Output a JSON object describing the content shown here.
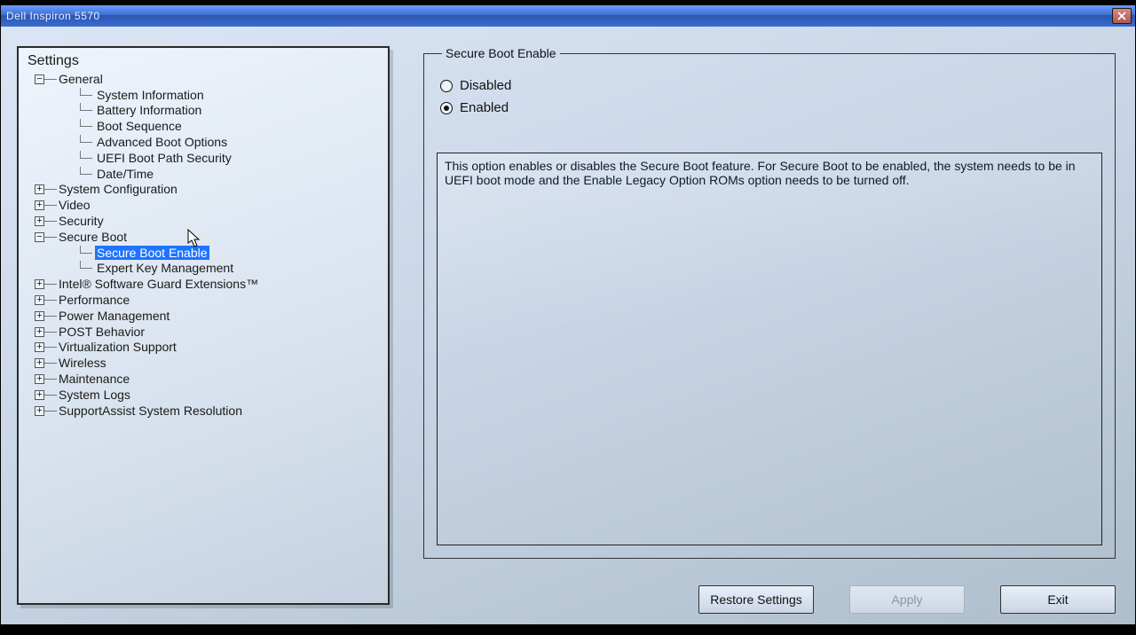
{
  "window": {
    "title": "Dell Inspiron 5570"
  },
  "tree": {
    "heading": "Settings",
    "nodes": [
      {
        "label": "General",
        "state": "expanded",
        "children": [
          {
            "label": "System Information"
          },
          {
            "label": "Battery Information"
          },
          {
            "label": "Boot Sequence"
          },
          {
            "label": "Advanced Boot Options"
          },
          {
            "label": "UEFI Boot Path Security"
          },
          {
            "label": "Date/Time"
          }
        ]
      },
      {
        "label": "System Configuration",
        "state": "collapsed"
      },
      {
        "label": "Video",
        "state": "collapsed"
      },
      {
        "label": "Security",
        "state": "collapsed"
      },
      {
        "label": "Secure Boot",
        "state": "expanded",
        "children": [
          {
            "label": "Secure Boot Enable",
            "selected": true
          },
          {
            "label": "Expert Key Management"
          }
        ]
      },
      {
        "label": "Intel® Software Guard Extensions™",
        "state": "collapsed"
      },
      {
        "label": "Performance",
        "state": "collapsed"
      },
      {
        "label": "Power Management",
        "state": "collapsed"
      },
      {
        "label": "POST Behavior",
        "state": "collapsed"
      },
      {
        "label": "Virtualization Support",
        "state": "collapsed"
      },
      {
        "label": "Wireless",
        "state": "collapsed"
      },
      {
        "label": "Maintenance",
        "state": "collapsed"
      },
      {
        "label": "System Logs",
        "state": "collapsed"
      },
      {
        "label": "SupportAssist System Resolution",
        "state": "collapsed"
      }
    ]
  },
  "panel": {
    "legend": "Secure Boot Enable",
    "options": {
      "disabled_label": "Disabled",
      "enabled_label": "Enabled",
      "selected": "Enabled"
    },
    "description": "This option enables or disables the Secure Boot feature. For Secure Boot to be enabled, the system needs to be in UEFI boot mode and the Enable Legacy Option ROMs option needs to be turned off."
  },
  "buttons": {
    "restore": "Restore Settings",
    "apply": "Apply",
    "exit": "Exit"
  }
}
